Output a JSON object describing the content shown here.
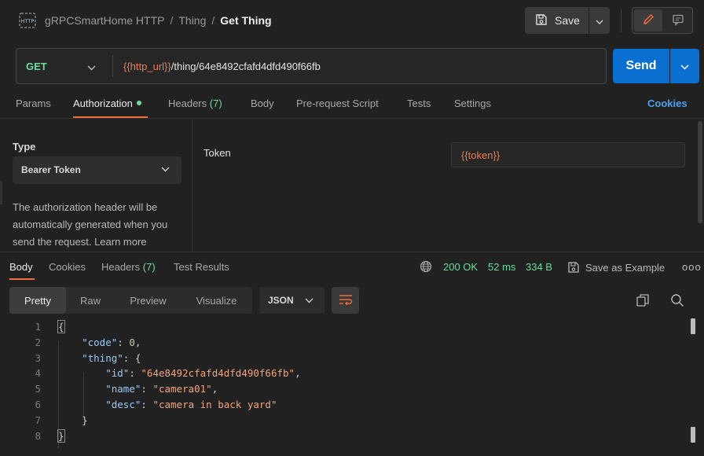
{
  "header": {
    "icon": "http-icon",
    "breadcrumb": [
      "gRPCSmartHome HTTP",
      "Thing"
    ],
    "current": "Get Thing",
    "separator": "/",
    "save_label": "Save"
  },
  "request": {
    "method": "GET",
    "url_variable": "{{http_url}}",
    "url_path": "/thing/64e8492cfafd4dfd490f66fb",
    "send_label": "Send"
  },
  "request_tabs": {
    "params": "Params",
    "authorization": "Authorization",
    "headers": "Headers",
    "headers_count": "(7)",
    "body": "Body",
    "prerequest": "Pre-request Script",
    "tests": "Tests",
    "settings": "Settings",
    "cookies": "Cookies",
    "active": "Authorization"
  },
  "auth": {
    "type_label": "Type",
    "type_value": "Bearer Token",
    "description": "The authorization header will be automatically generated when you send the request. Learn more",
    "token_label": "Token",
    "token_value": "{{token}}"
  },
  "response_tabs": {
    "body": "Body",
    "cookies": "Cookies",
    "headers": "Headers",
    "headers_count": "(7)",
    "test_results": "Test Results",
    "status": "200 OK",
    "time": "52 ms",
    "size": "334 B",
    "save_example": "Save as Example",
    "more": "ooo"
  },
  "response_toolbar": {
    "views": [
      "Pretty",
      "Raw",
      "Preview",
      "Visualize"
    ],
    "active_view": "Pretty",
    "format": "JSON"
  },
  "code": {
    "line_numbers": [
      "1",
      "2",
      "3",
      "4",
      "5",
      "6",
      "7",
      "8"
    ],
    "lines": [
      [
        {
          "t": "{",
          "c": "p"
        }
      ],
      [
        {
          "t": "    ",
          "c": "p"
        },
        {
          "t": "\"code\"",
          "c": "k"
        },
        {
          "t": ": ",
          "c": "p"
        },
        {
          "t": "0",
          "c": "n"
        },
        {
          "t": ",",
          "c": "p"
        }
      ],
      [
        {
          "t": "    ",
          "c": "p"
        },
        {
          "t": "\"thing\"",
          "c": "k"
        },
        {
          "t": ": {",
          "c": "p"
        }
      ],
      [
        {
          "t": "        ",
          "c": "p"
        },
        {
          "t": "\"id\"",
          "c": "k"
        },
        {
          "t": ": ",
          "c": "p"
        },
        {
          "t": "\"64e8492cfafd4dfd490f66fb\"",
          "c": "s"
        },
        {
          "t": ",",
          "c": "p"
        }
      ],
      [
        {
          "t": "        ",
          "c": "p"
        },
        {
          "t": "\"name\"",
          "c": "k"
        },
        {
          "t": ": ",
          "c": "p"
        },
        {
          "t": "\"camera01\"",
          "c": "s"
        },
        {
          "t": ",",
          "c": "p"
        }
      ],
      [
        {
          "t": "        ",
          "c": "p"
        },
        {
          "t": "\"desc\"",
          "c": "k"
        },
        {
          "t": ": ",
          "c": "p"
        },
        {
          "t": "\"camera in back yard\"",
          "c": "s"
        }
      ],
      [
        {
          "t": "    }",
          "c": "p"
        }
      ],
      [
        {
          "t": "}",
          "c": "p"
        }
      ]
    ]
  },
  "colors": {
    "accent": "#f26b3a",
    "send": "#0a6fd0",
    "method": "#6bdd9a",
    "variable": "#f07c4f",
    "link": "#4ba3f5"
  }
}
